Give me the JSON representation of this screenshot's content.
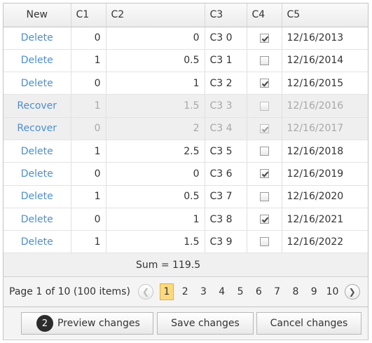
{
  "columns": {
    "new": "New",
    "c1": "C1",
    "c2": "C2",
    "c3": "C3",
    "c4": "C4",
    "c5": "C5"
  },
  "rows": [
    {
      "command": "Delete",
      "c1": "0",
      "c2": "0",
      "c3": "C3 0",
      "c4": true,
      "c5": "12/16/2013",
      "deleted": false
    },
    {
      "command": "Delete",
      "c1": "1",
      "c2": "0.5",
      "c3": "C3 1",
      "c4": false,
      "c5": "12/16/2014",
      "deleted": false
    },
    {
      "command": "Delete",
      "c1": "0",
      "c2": "1",
      "c3": "C3 2",
      "c4": true,
      "c5": "12/16/2015",
      "deleted": false
    },
    {
      "command": "Recover",
      "c1": "1",
      "c2": "1.5",
      "c3": "C3 3",
      "c4": false,
      "c5": "12/16/2016",
      "deleted": true
    },
    {
      "command": "Recover",
      "c1": "0",
      "c2": "2",
      "c3": "C3 4",
      "c4": true,
      "c5": "12/16/2017",
      "deleted": true
    },
    {
      "command": "Delete",
      "c1": "1",
      "c2": "2.5",
      "c3": "C3 5",
      "c4": false,
      "c5": "12/16/2018",
      "deleted": false
    },
    {
      "command": "Delete",
      "c1": "0",
      "c2": "0",
      "c3": "C3 6",
      "c4": true,
      "c5": "12/16/2019",
      "deleted": false
    },
    {
      "command": "Delete",
      "c1": "1",
      "c2": "0.5",
      "c3": "C3 7",
      "c4": false,
      "c5": "12/16/2020",
      "deleted": false
    },
    {
      "command": "Delete",
      "c1": "0",
      "c2": "1",
      "c3": "C3 8",
      "c4": true,
      "c5": "12/16/2021",
      "deleted": false
    },
    {
      "command": "Delete",
      "c1": "1",
      "c2": "1.5",
      "c3": "C3 9",
      "c4": false,
      "c5": "12/16/2022",
      "deleted": false
    }
  ],
  "summary": {
    "sum_text": "Sum = 119.5"
  },
  "pager": {
    "info": "Page 1 of 10 (100 items)",
    "prev_icon": "chevron-left-icon",
    "next_icon": "chevron-right-icon",
    "pages": [
      "1",
      "2",
      "3",
      "4",
      "5",
      "6",
      "7",
      "8",
      "9",
      "10"
    ],
    "current": "1"
  },
  "toolbar": {
    "pending_count": "2",
    "preview_label": "Preview changes",
    "save_label": "Save changes",
    "cancel_label": "Cancel changes"
  },
  "colors": {
    "link": "#4a8fcf",
    "current_page": "#fbd980",
    "deleted_row_bg": "#efefef",
    "badge_bg": "#2c2c2c"
  }
}
